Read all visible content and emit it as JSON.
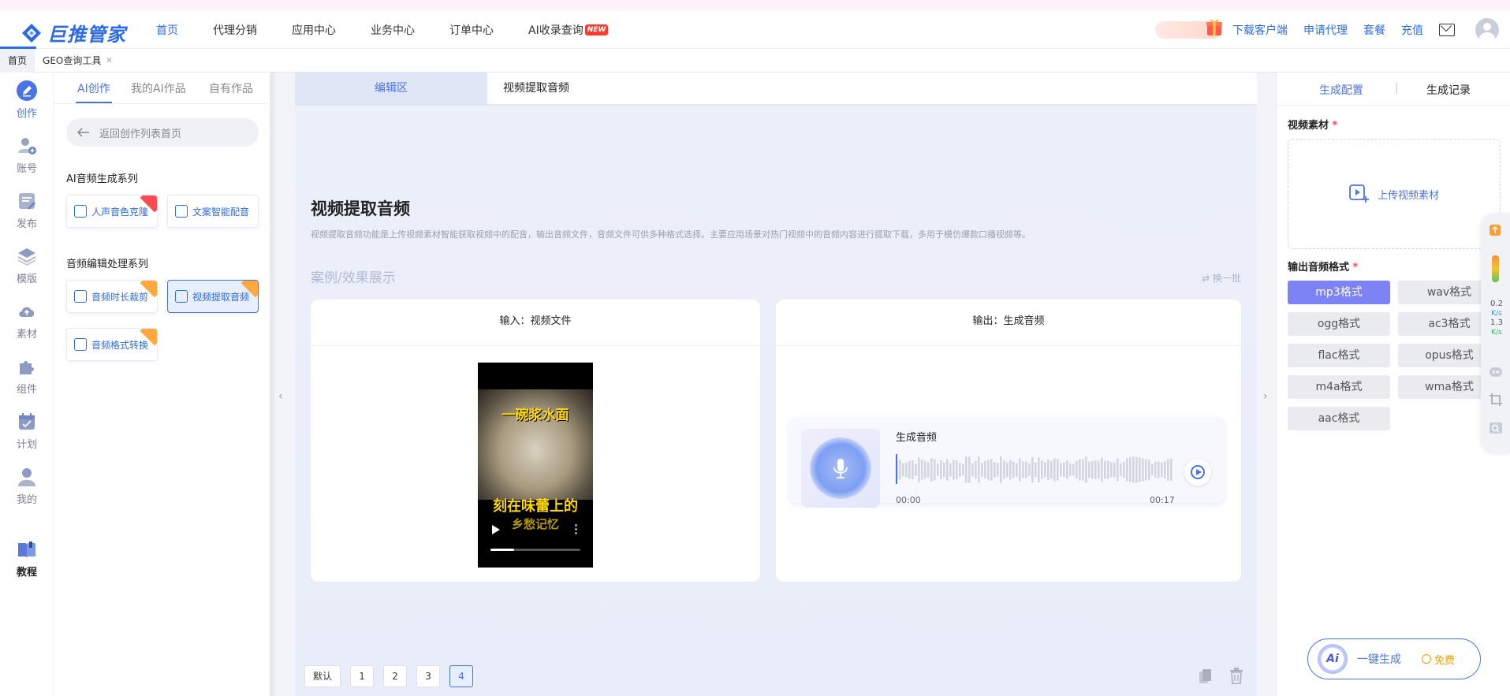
{
  "brand": {
    "name": "巨推管家",
    "accent": "#2c6be8",
    "hover_underline": true
  },
  "nav": {
    "items": [
      {
        "label": "首页",
        "active": true
      },
      {
        "label": "代理分销"
      },
      {
        "label": "应用中心"
      },
      {
        "label": "业务中心"
      },
      {
        "label": "订单中心"
      },
      {
        "label": "AI收录查询",
        "badge": "NEW"
      }
    ],
    "right": {
      "download": "下载客户端",
      "agent": "申请代理",
      "package": "套餐",
      "recharge": "充值"
    }
  },
  "page_tabs": [
    {
      "label": "首页",
      "active": true
    },
    {
      "label": "GEO查询工具",
      "close": "×"
    }
  ],
  "leftbar": {
    "items": [
      {
        "label": "创作",
        "icon": "pen-icon",
        "active": true
      },
      {
        "label": "账号",
        "icon": "user-add-icon"
      },
      {
        "label": "发布",
        "icon": "publish-icon"
      },
      {
        "label": "模版",
        "icon": "layers-icon"
      },
      {
        "label": "素材",
        "icon": "cloud-upload-icon"
      },
      {
        "label": "组件",
        "icon": "puzzle-icon"
      },
      {
        "label": "计划",
        "icon": "calendar-icon"
      },
      {
        "label": "我的",
        "icon": "person-icon"
      },
      {
        "label": "教程",
        "icon": "book-icon"
      }
    ]
  },
  "subpanel": {
    "tabs": [
      "AI创作",
      "我的AI作品",
      "自有作品"
    ],
    "back_label": "返回创作列表首页",
    "section1": "AI音频生成系列",
    "section2": "音频编辑处理系列",
    "cards": [
      {
        "label": "人声音色克隆",
        "ribbon": "red"
      },
      {
        "label": "文案智能配音"
      },
      {
        "label": "音频时长裁剪",
        "ribbon": "orange"
      },
      {
        "label": "视频提取音频",
        "ribbon": "orange",
        "selected": true
      },
      {
        "label": "音频格式转换",
        "ribbon": "orange"
      }
    ]
  },
  "main": {
    "tabs": [
      "编辑区",
      "视频提取音频"
    ],
    "title": "视频提取音频",
    "description": "视频提取音频功能是上传视频素材智能获取视频中的配音，输出音频文件，音频文件可供多种格式选择。主要应用场景对热门视频中的音频内容进行提取下载，多用于模仿爆款口播视频等。",
    "case_title": "案例/效果展示",
    "swap_label": "换一批",
    "input_header": "输入：视频文件",
    "output_header": "输出：生成音频",
    "video_caption_top": "一碗浆水面",
    "video_caption_bottom": "刻在味蕾上的",
    "video_caption_cut": "乡愁记忆",
    "audio": {
      "title": "生成音频",
      "start": "00:00",
      "end": "00:17"
    },
    "pager": [
      "默认",
      "1",
      "2",
      "3",
      "4"
    ],
    "pager_current": "4"
  },
  "right": {
    "tabs": {
      "config": "生成配置",
      "sep": "|",
      "history": "生成记录"
    },
    "video_label": "视频素材",
    "required": "*",
    "upload_label": "上传视频素材",
    "format_label": "输出音频格式",
    "formats": [
      "mp3格式",
      "wav格式",
      "ogg格式",
      "ac3格式",
      "flac格式",
      "opus格式",
      "m4a格式",
      "wma格式",
      "aac格式"
    ],
    "selected_format": "mp3格式",
    "float": {
      "up": "0.2",
      "down": "1.3",
      "unit": "K/s"
    },
    "generate": {
      "ai": "Ai",
      "label": "一键生成",
      "free": "免费"
    }
  }
}
